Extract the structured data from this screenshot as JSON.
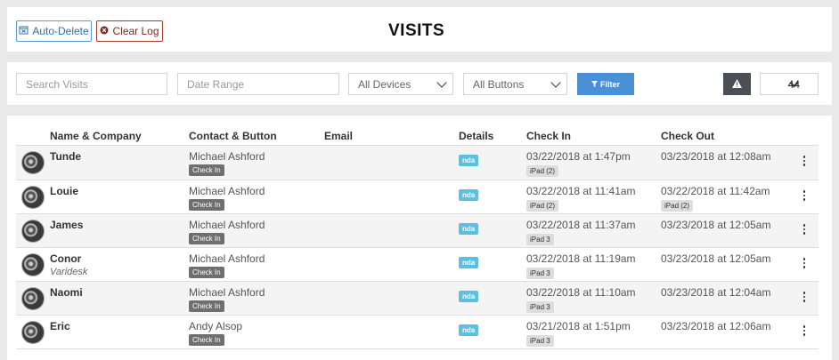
{
  "header": {
    "auto_delete_label": "Auto-Delete",
    "clear_log_label": "Clear Log",
    "title": "VISITS"
  },
  "filters": {
    "search_placeholder": "Search Visits",
    "date_placeholder": "Date Range",
    "devices_value": "All Devices",
    "buttons_value": "All Buttons",
    "filter_label": "Filter",
    "per_page_value": "44"
  },
  "table": {
    "columns": [
      "Name & Company",
      "Contact & Button",
      "Email",
      "Details",
      "Check In",
      "Check Out"
    ],
    "rows": [
      {
        "name": "Tunde",
        "company": "",
        "contact": "Michael Ashford",
        "button": "Check In",
        "details": "nda",
        "check_in": "03/22/2018 at 1:47pm",
        "check_in_device": "iPad (2)",
        "check_out": "03/23/2018 at 12:08am",
        "check_out_device": ""
      },
      {
        "name": "Louie",
        "company": "",
        "contact": "Michael Ashford",
        "button": "Check In",
        "details": "nda",
        "check_in": "03/22/2018 at 11:41am",
        "check_in_device": "iPad (2)",
        "check_out": "03/22/2018 at 11:42am",
        "check_out_device": "iPad (2)"
      },
      {
        "name": "James",
        "company": "",
        "contact": "Michael Ashford",
        "button": "Check In",
        "details": "nda",
        "check_in": "03/22/2018 at 11:37am",
        "check_in_device": "iPad 3",
        "check_out": "03/23/2018 at 12:05am",
        "check_out_device": ""
      },
      {
        "name": "Conor",
        "company": "Varidesk",
        "contact": "Michael Ashford",
        "button": "Check In",
        "details": "nda",
        "check_in": "03/22/2018 at 11:19am",
        "check_in_device": "iPad 3",
        "check_out": "03/23/2018 at 12:05am",
        "check_out_device": ""
      },
      {
        "name": "Naomi",
        "company": "",
        "contact": "Michael Ashford",
        "button": "Check In",
        "details": "nda",
        "check_in": "03/22/2018 at 11:10am",
        "check_in_device": "iPad 3",
        "check_out": "03/23/2018 at 12:04am",
        "check_out_device": ""
      },
      {
        "name": "Eric",
        "company": "",
        "contact": "Andy Alsop",
        "button": "Check In",
        "details": "nda",
        "check_in": "03/21/2018 at 1:51pm",
        "check_in_device": "iPad 3",
        "check_out": "03/23/2018 at 12:06am",
        "check_out_device": ""
      }
    ]
  },
  "colors": {
    "primary": "#4a90d4",
    "danger_border": "#a83a2c",
    "info_tag": "#5bc0de",
    "dark_tag": "#6f6f6f"
  },
  "icons": {
    "auto_delete": "calendar-x-icon",
    "clear_log": "times-circle-icon",
    "filter": "filter-icon",
    "warning": "warning-icon",
    "row_menu": "kebab-menu-icon"
  }
}
